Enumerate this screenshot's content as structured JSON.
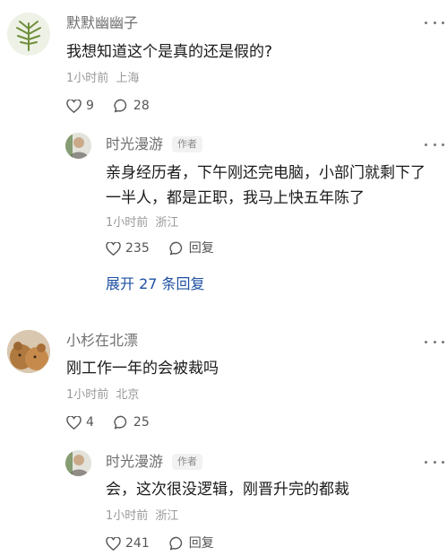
{
  "comments": [
    {
      "user": "默默幽幽子",
      "text": "我想知道这个是真的还是假的?",
      "time": "1小时前",
      "location": "上海",
      "likes": "9",
      "replies": "28",
      "reply": {
        "user": "时光漫游",
        "author_tag": "作者",
        "text_line1": "亲身经历者，下午刚还完电脑，小部门就剩下了",
        "text_line2": "一半人，都是正职，我马上快五年陈了",
        "time": "1小时前",
        "location": "浙江",
        "likes": "235",
        "reply_label": "回复"
      },
      "expand_label": "展开 27 条回复"
    },
    {
      "user": "小杉在北漂",
      "text": "刚工作一年的会被裁吗",
      "time": "1小时前",
      "location": "北京",
      "likes": "4",
      "replies": "25",
      "reply": {
        "user": "时光漫游",
        "author_tag": "作者",
        "text_line1": "会，这次很没逻辑，刚晋升完的都裁",
        "time": "1小时前",
        "location": "浙江",
        "likes": "241",
        "reply_label": "回复"
      }
    }
  ],
  "icons": [
    "heart-icon",
    "comment-icon",
    "reply-icon",
    "more-icon"
  ]
}
